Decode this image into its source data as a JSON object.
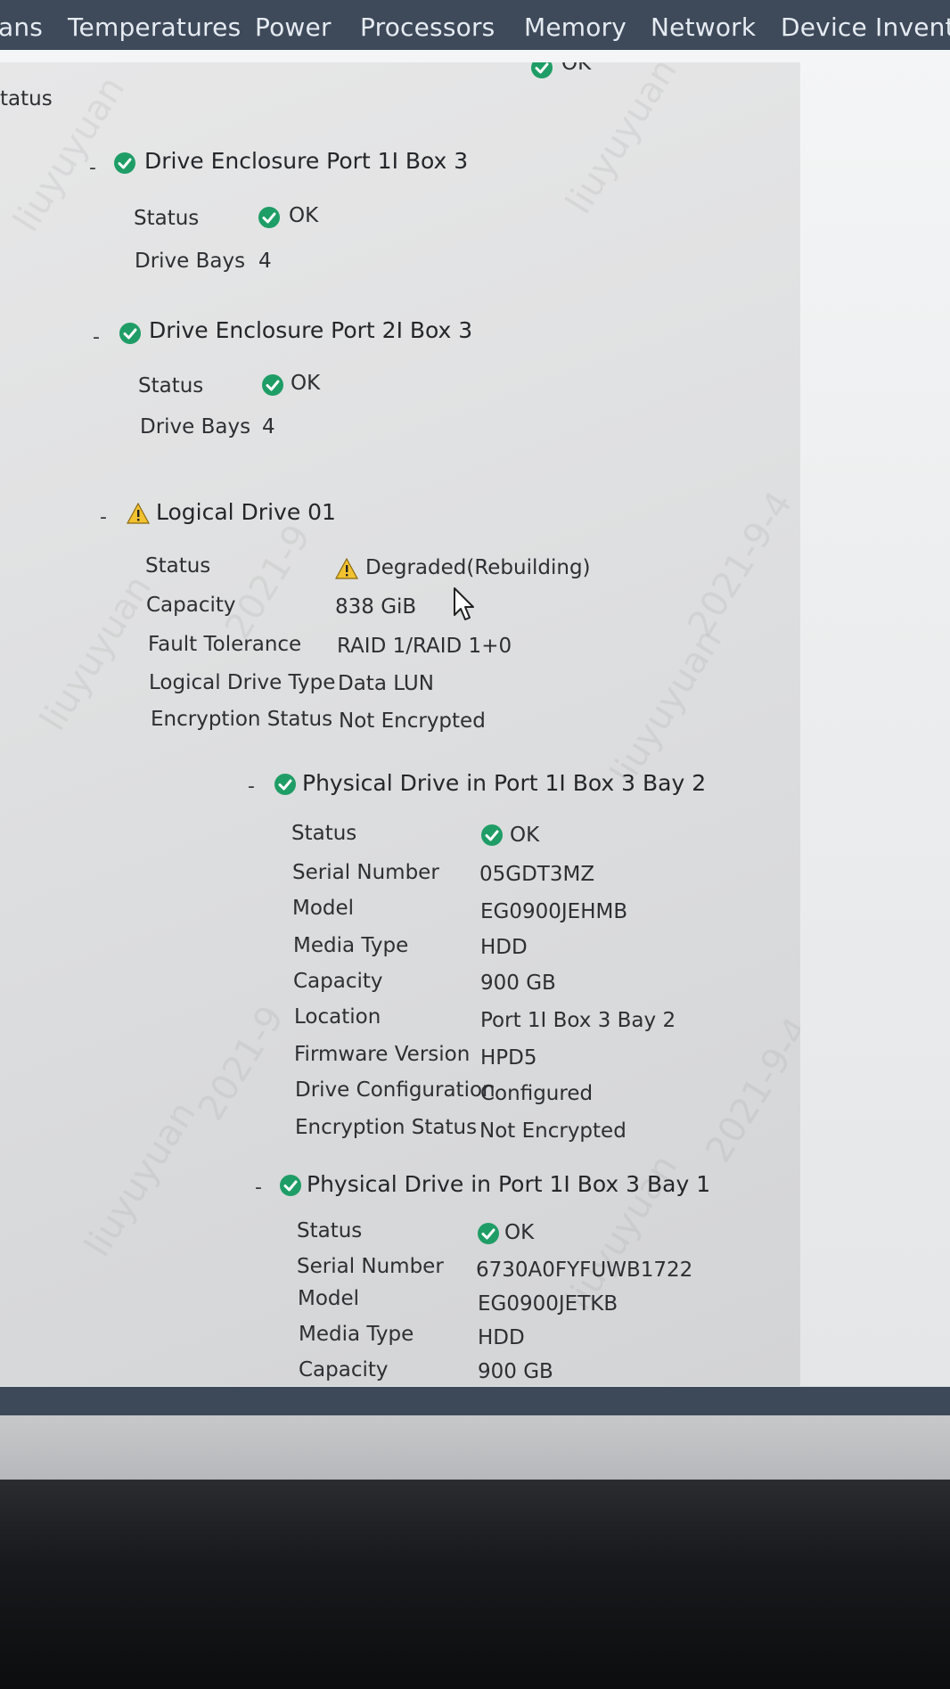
{
  "topnav": {
    "tabs": [
      "ans",
      "Temperatures",
      "Power",
      "Processors",
      "Memory",
      "Network",
      "Device Invento"
    ]
  },
  "colors": {
    "ok": "#1f9d66",
    "warning": "#f2c230",
    "nav": "#3e4a5a"
  },
  "panel": {
    "top_status_value": "OK",
    "section_label": "tatus",
    "enclosures": [
      {
        "title": "Drive Enclosure Port 1I Box 3",
        "status_label": "Status",
        "status_value": "OK",
        "bays_label": "Drive Bays",
        "bays_value": "4"
      },
      {
        "title": "Drive Enclosure Port 2I Box 3",
        "status_label": "Status",
        "status_value": "OK",
        "bays_label": "Drive Bays",
        "bays_value": "4"
      }
    ],
    "logical_drive": {
      "title": "Logical Drive 01",
      "rows": [
        {
          "label": "Status",
          "value": "Degraded(Rebuilding)"
        },
        {
          "label": "Capacity",
          "value": "838 GiB"
        },
        {
          "label": "Fault Tolerance",
          "value": "RAID 1/RAID 1+0"
        },
        {
          "label": "Logical Drive Type",
          "value": "Data LUN"
        },
        {
          "label": "Encryption Status",
          "value": "Not Encrypted"
        }
      ]
    },
    "physical_drives": [
      {
        "title": "Physical Drive in Port 1I Box 3 Bay 2",
        "rows": [
          {
            "label": "Status",
            "value": "OK"
          },
          {
            "label": "Serial Number",
            "value": "05GDT3MZ"
          },
          {
            "label": "Model",
            "value": "EG0900JEHMB"
          },
          {
            "label": "Media Type",
            "value": "HDD"
          },
          {
            "label": "Capacity",
            "value": "900 GB"
          },
          {
            "label": "Location",
            "value": "Port 1I Box 3 Bay 2"
          },
          {
            "label": "Firmware Version",
            "value": "HPD5"
          },
          {
            "label": "Drive Configuration",
            "value": "Configured"
          },
          {
            "label": "Encryption Status",
            "value": "Not Encrypted"
          }
        ]
      },
      {
        "title": "Physical Drive in Port 1I Box 3 Bay 1",
        "rows": [
          {
            "label": "Status",
            "value": "OK"
          },
          {
            "label": "Serial Number",
            "value": "6730A0FYFUWB1722"
          },
          {
            "label": "Model",
            "value": "EG0900JETKB"
          },
          {
            "label": "Media Type",
            "value": "HDD"
          },
          {
            "label": "Capacity",
            "value": "900 GB"
          }
        ]
      }
    ]
  }
}
